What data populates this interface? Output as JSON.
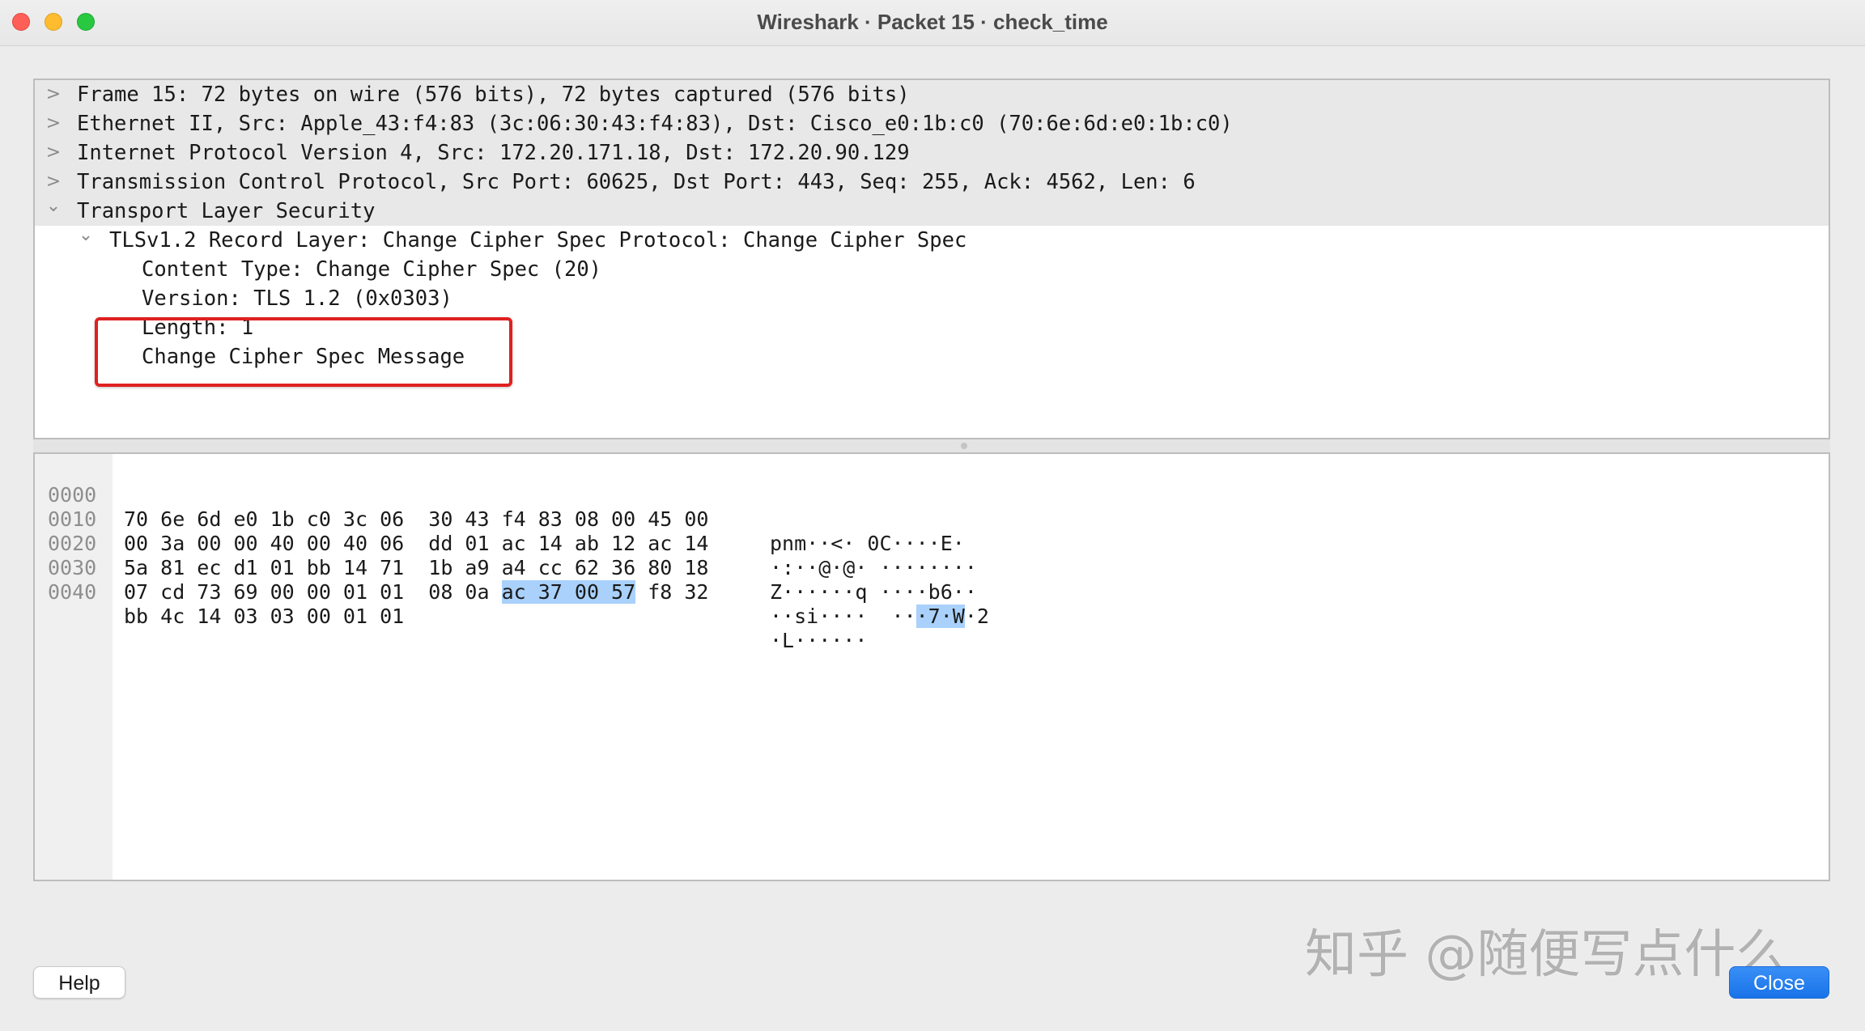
{
  "window": {
    "title": "Wireshark · Packet 15 · check_time"
  },
  "tree": [
    {
      "text": "Frame 15: 72 bytes on wire (576 bits), 72 bytes captured (576 bits)",
      "arrow": ">"
    },
    {
      "text": "Ethernet II, Src: Apple_43:f4:83 (3c:06:30:43:f4:83), Dst: Cisco_e0:1b:c0 (70:6e:6d:e0:1b:c0)",
      "arrow": ">"
    },
    {
      "text": "Internet Protocol Version 4, Src: 172.20.171.18, Dst: 172.20.90.129",
      "arrow": ">"
    },
    {
      "text": "Transmission Control Protocol, Src Port: 60625, Dst Port: 443, Seq: 255, Ack: 4562, Len: 6",
      "arrow": ">"
    },
    {
      "text": "Transport Layer Security",
      "arrow": "⌄"
    },
    {
      "text": "TLSv1.2 Record Layer: Change Cipher Spec Protocol: Change Cipher Spec",
      "arrow": "⌄"
    },
    {
      "text": "Content Type: Change Cipher Spec (20)",
      "arrow": ""
    },
    {
      "text": "Version: TLS 1.2 (0x0303)",
      "arrow": ""
    },
    {
      "text": "Length: 1",
      "arrow": ""
    },
    {
      "text": "Change Cipher Spec Message",
      "arrow": ""
    }
  ],
  "bytes": [
    {
      "offset": "0000",
      "hex_a": "70 6e 6d e0 1b c0 3c 06  30 43 f4 83 08 00 45 00",
      "hex_sel": "",
      "hex_b": "",
      "ascii_a": "pnm··<· 0C····E·",
      "ascii_sel": "",
      "ascii_b": ""
    },
    {
      "offset": "0010",
      "hex_a": "00 3a 00 00 40 00 40 06  dd 01 ac 14 ab 12 ac 14",
      "hex_sel": "",
      "hex_b": "",
      "ascii_a": "·:··@·@· ········",
      "ascii_sel": "",
      "ascii_b": ""
    },
    {
      "offset": "0020",
      "hex_a": "5a 81 ec d1 01 bb 14 71  1b a9 a4 cc 62 36 80 18",
      "hex_sel": "",
      "hex_b": "",
      "ascii_a": "Z······q ····b6··",
      "ascii_sel": "",
      "ascii_b": ""
    },
    {
      "offset": "0030",
      "hex_a": "07 cd 73 69 00 00 01 01  08 0a ",
      "hex_sel": "ac 37 00 57",
      "hex_b": " f8 32",
      "ascii_a": "··si····  ··",
      "ascii_sel": "·7·W",
      "ascii_b": "·2"
    },
    {
      "offset": "0040",
      "hex_a": "bb 4c 14 03 03 00 01 01",
      "hex_sel": "",
      "hex_b": "",
      "ascii_a": "·L······",
      "ascii_sel": "",
      "ascii_b": ""
    }
  ],
  "buttons": {
    "help": "Help",
    "close": "Close"
  },
  "watermark": "知乎 @随便写点什么",
  "colors": {
    "highlight_box": "#e02020",
    "selection": "#a9d1fb",
    "close_button": "#1873e8"
  }
}
